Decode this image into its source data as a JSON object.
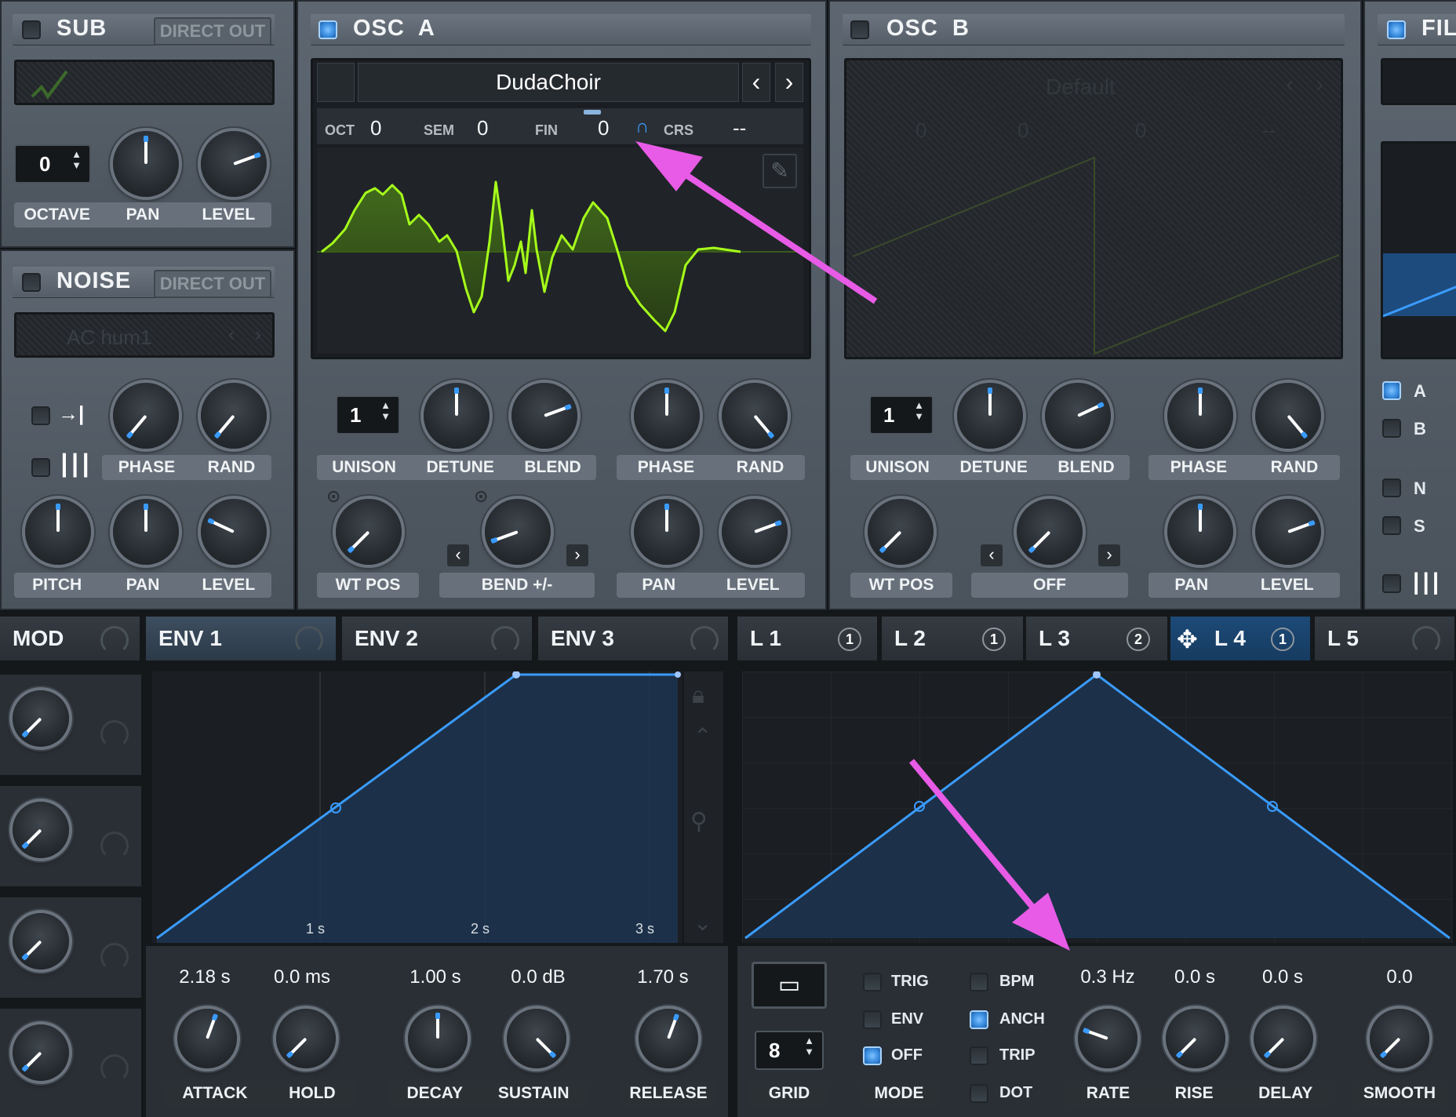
{
  "sub": {
    "title": "SUB",
    "direct_out": "DIRECT OUT",
    "octave_value": "0",
    "labels": [
      "OCTAVE",
      "PAN",
      "LEVEL"
    ]
  },
  "noise": {
    "title": "NOISE",
    "direct_out": "DIRECT OUT",
    "sample": "AC hum1",
    "labels_top": [
      "PHASE",
      "RAND"
    ],
    "labels_bottom": [
      "PITCH",
      "PAN",
      "LEVEL"
    ]
  },
  "osc_a": {
    "title": "OSC  A",
    "wavetable": "DudaChoir",
    "oct_label": "OCT",
    "oct_value": "0",
    "sem_label": "SEM",
    "sem_value": "0",
    "fin_label": "FIN",
    "fin_value": "0",
    "crs_label": "CRS",
    "crs_value": "--",
    "unison_value": "1",
    "labels_row1": [
      "UNISON",
      "DETUNE",
      "BLEND"
    ],
    "labels_row1b": [
      "PHASE",
      "RAND"
    ],
    "labels_row2": [
      "WT POS",
      "BEND +/-"
    ],
    "labels_row2b": [
      "PAN",
      "LEVEL"
    ]
  },
  "osc_b": {
    "title": "OSC  B",
    "wavetable": "Default",
    "disabled_values": [
      "0",
      "0",
      "0",
      "--"
    ],
    "unison_value": "1",
    "labels_row1": [
      "UNISON",
      "DETUNE",
      "BLEND"
    ],
    "labels_row1b": [
      "PHASE",
      "RAND"
    ],
    "labels_row2": [
      "WT POS",
      "OFF"
    ],
    "labels_row2b": [
      "PAN",
      "LEVEL"
    ]
  },
  "filter": {
    "title": "FILT",
    "routes": [
      "A",
      "B",
      "N",
      "S"
    ]
  },
  "mod": {
    "title": "MOD"
  },
  "env_tabs": [
    "ENV 1",
    "ENV 2",
    "ENV 3"
  ],
  "lfo_tabs": [
    {
      "label": "L 1",
      "count": "1"
    },
    {
      "label": "L 2",
      "count": "1"
    },
    {
      "label": "L 3",
      "count": "2"
    },
    {
      "label": "L 4",
      "count": "1"
    },
    {
      "label": "L 5",
      "count": ""
    }
  ],
  "env": {
    "time_marks": [
      "1 s",
      "2 s",
      "3 s"
    ],
    "values": [
      "2.18 s",
      "0.0 ms",
      "1.00 s",
      "0.0 dB",
      "1.70 s"
    ],
    "labels": [
      "ATTACK",
      "HOLD",
      "DECAY",
      "SUSTAIN",
      "RELEASE"
    ]
  },
  "lfo": {
    "grid_value": "8",
    "grid_label": "GRID",
    "mode_label": "MODE",
    "mode_options": [
      "TRIG",
      "ENV",
      "OFF"
    ],
    "bpm_options": [
      "BPM",
      "ANCH",
      "TRIP",
      "DOT"
    ],
    "values": [
      "0.3 Hz",
      "0.0 s",
      "0.0 s",
      "0.0"
    ],
    "labels": [
      "RATE",
      "RISE",
      "DELAY",
      "SMOOTH"
    ]
  },
  "colors": {
    "accent": "#3a9bff",
    "wave": "#a6ff1a",
    "annotation": "#e85be6"
  }
}
